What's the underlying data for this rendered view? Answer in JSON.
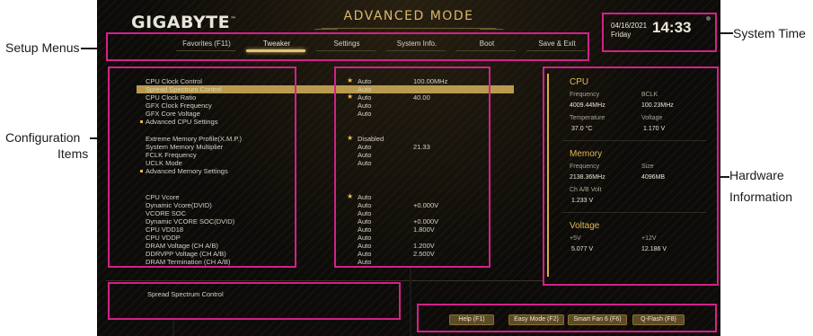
{
  "bios": {
    "brand": "GIGABYTE",
    "brand_mark": "™",
    "mode_title": "ADVANCED MODE",
    "date": "04/16/2021",
    "day": "Friday",
    "time": "14:33",
    "tabs": [
      "Favorites (F11)",
      "Tweaker",
      "Settings",
      "System Info.",
      "Boot",
      "Save & Exit"
    ],
    "active_tab": "Tweaker",
    "config_items": [
      {
        "label": "CPU Clock Control",
        "star": true,
        "value": "Auto",
        "extra": "100.00MHz"
      },
      {
        "label": "Spread Spectrum Control",
        "star": false,
        "value": "Auto",
        "extra": ""
      },
      {
        "label": "CPU Clock Ratio",
        "star": true,
        "value": "Auto",
        "extra": "40.00"
      },
      {
        "label": "GFX Clock Frequency",
        "star": false,
        "value": "Auto",
        "extra": ""
      },
      {
        "label": "GFX Core Voltage",
        "star": false,
        "value": "Auto",
        "extra": ""
      },
      {
        "label": "Advanced CPU Settings",
        "bullet": true
      },
      {
        "label": "Extreme Memory Profile(X.M.P.)",
        "star": true,
        "value": "Disabled",
        "extra": ""
      },
      {
        "label": "System Memory Multiplier",
        "star": false,
        "value": "Auto",
        "extra": "21.33"
      },
      {
        "label": "FCLK Frequency",
        "star": false,
        "value": "Auto",
        "extra": ""
      },
      {
        "label": "UCLK Mode",
        "star": false,
        "value": "Auto",
        "extra": ""
      },
      {
        "label": "Advanced Memory Settings",
        "bullet": true
      },
      {
        "label": "CPU Vcore",
        "star": true,
        "value": "Auto",
        "extra": ""
      },
      {
        "label": "Dynamic Vcore(DVID)",
        "star": false,
        "value": "Auto",
        "extra": "+0.000V"
      },
      {
        "label": "VCORE SOC",
        "star": false,
        "value": "Auto",
        "extra": ""
      },
      {
        "label": "Dynamic VCORE SOC(DVID)",
        "star": false,
        "value": "Auto",
        "extra": "+0.000V"
      },
      {
        "label": "CPU VDD18",
        "star": false,
        "value": "Auto",
        "extra": "1.800V"
      },
      {
        "label": "CPU VDDP",
        "star": false,
        "value": "Auto",
        "extra": ""
      },
      {
        "label": "DRAM Voltage    (CH A/B)",
        "star": false,
        "value": "Auto",
        "extra": "1.200V"
      },
      {
        "label": "DDRVPP Voltage   (CH A/B)",
        "star": false,
        "value": "Auto",
        "extra": "2.500V"
      },
      {
        "label": "DRAM Termination  (CH A/B)",
        "star": false,
        "value": "Auto",
        "extra": ""
      }
    ],
    "help_text": "Spread Spectrum Control",
    "hardware": {
      "cpu": {
        "title": "CPU",
        "frequency_label": "Frequency",
        "frequency": "4009.44MHz",
        "bclk_label": "BCLK",
        "bclk": "100.23MHz",
        "temp_label": "Temperature",
        "temp": "37.0 °C",
        "voltage_label": "Voltage",
        "voltage": "1.170 V"
      },
      "memory": {
        "title": "Memory",
        "frequency_label": "Frequency",
        "frequency": "2138.36MHz",
        "size_label": "Size",
        "size": "4096MB",
        "volt_label": "Ch A/B Volt",
        "volt": "1.233 V"
      },
      "voltage": {
        "title": "Voltage",
        "p5_label": "+5V",
        "p5": "5.077 V",
        "p12_label": "+12V",
        "p12": "12.186 V"
      }
    },
    "buttons": [
      "Help (F1)",
      "Easy Mode (F2)",
      "Smart Fan 6 (F6)",
      "Q-Flash (F8)"
    ]
  },
  "annotations": {
    "setup_menus": "Setup Menus",
    "system_time": "System Time",
    "configuration": "Configuration",
    "items": "Items",
    "hardware": "Hardware",
    "information": "Information"
  },
  "colors": {
    "annotation_box": "#d5208a",
    "accent": "#e0b953",
    "highlight_row": "#b99a4e"
  }
}
